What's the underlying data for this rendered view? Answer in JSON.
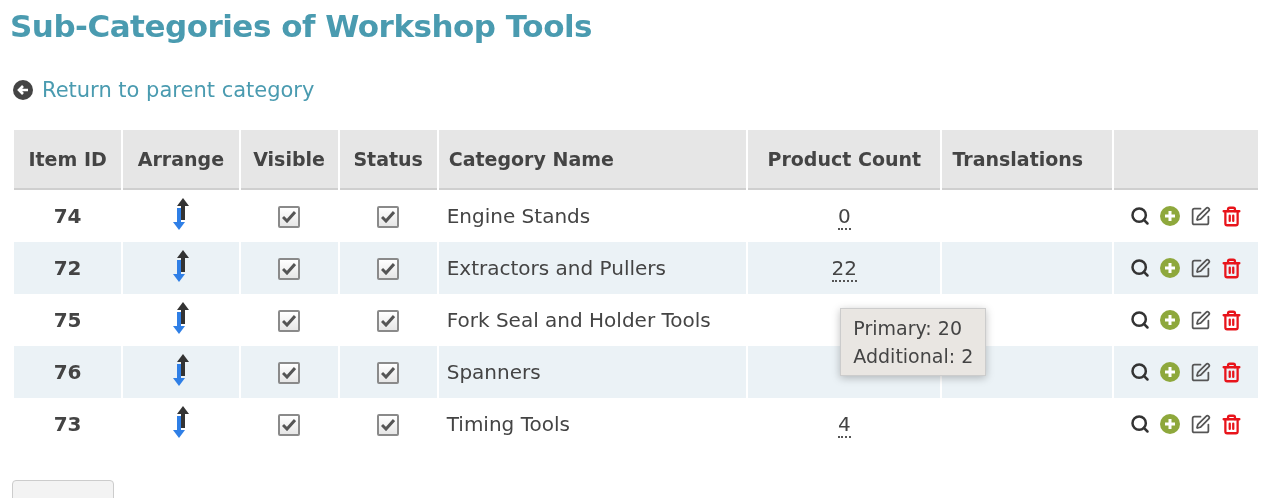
{
  "title": "Sub-Categories of Workshop Tools",
  "back_link": {
    "label": "Return to parent category"
  },
  "table": {
    "columns": [
      "Item ID",
      "Arrange",
      "Visible",
      "Status",
      "Category Name",
      "Product Count",
      "Translations"
    ],
    "rows": [
      {
        "id": "74",
        "visible": true,
        "status": true,
        "name": "Engine Stands",
        "count": "0"
      },
      {
        "id": "72",
        "visible": true,
        "status": true,
        "name": "Extractors and Pullers",
        "count": "22"
      },
      {
        "id": "75",
        "visible": true,
        "status": true,
        "name": "Fork Seal and Holder Tools",
        "tooltip": [
          "Primary: 20",
          "Additional: 2"
        ]
      },
      {
        "id": "76",
        "visible": true,
        "status": true,
        "name": "Spanners"
      },
      {
        "id": "73",
        "visible": true,
        "status": true,
        "name": "Timing Tools",
        "count": "4"
      }
    ]
  }
}
